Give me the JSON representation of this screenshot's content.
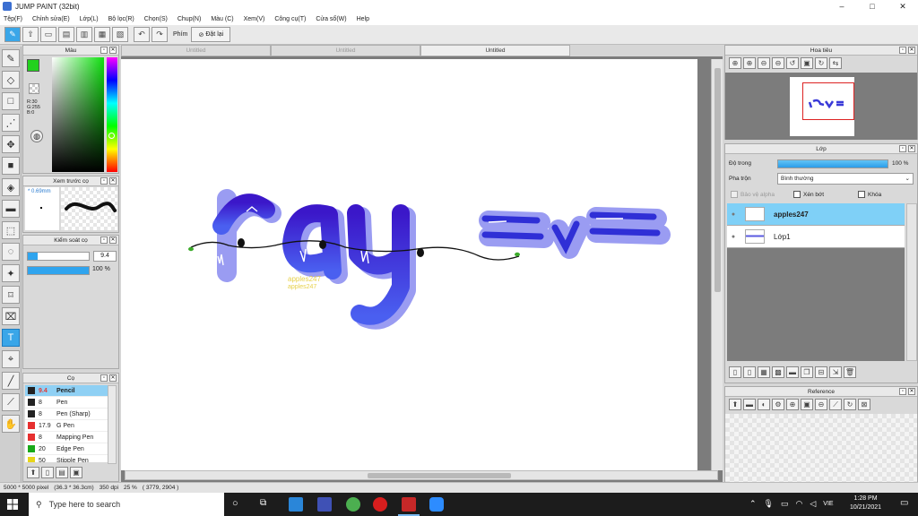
{
  "window": {
    "title": "JUMP PAINT (32bit)",
    "controls": [
      "–",
      "□",
      "✕"
    ]
  },
  "menu": [
    "Tệp(F)",
    "Chỉnh sửa(E)",
    "Lớp(L)",
    "Bộ lọc(R)",
    "Chọn(S)",
    "Chup(N)",
    "Màu (C)",
    "Xem(V)",
    "Công cụ(T)",
    "Cửa sổ(W)",
    "Help"
  ],
  "toolbar": {
    "phim_label": "Phím",
    "reset_label": "Đặt lại"
  },
  "tabs": [
    {
      "label": "Untitled",
      "active": false
    },
    {
      "label": "Untitled",
      "active": false
    },
    {
      "label": "Untitled",
      "active": true
    }
  ],
  "color_panel": {
    "title": "Màu",
    "values": [
      "R:30",
      "G:255",
      "B:0"
    ],
    "primary": "#22d11d",
    "secondary": "#f0d000"
  },
  "preview_panel": {
    "title": "Xem trước cọ",
    "size": "* 0.69mm"
  },
  "control_panel": {
    "title": "Kiểm soát cọ",
    "size_value": "9.4",
    "opacity_value": "100 %"
  },
  "brush_panel": {
    "title": "Cọ",
    "brushes": [
      {
        "size": "9.4",
        "name": "Pencil",
        "color": "#222222",
        "selected": true
      },
      {
        "size": "8",
        "name": "Pen",
        "color": "#222222"
      },
      {
        "size": "8",
        "name": "Pen (Sharp)",
        "color": "#222222"
      },
      {
        "size": "17.9",
        "name": "G Pen",
        "color": "#e63030"
      },
      {
        "size": "8",
        "name": "Mapping Pen",
        "color": "#e63030"
      },
      {
        "size": "20",
        "name": "Edge Pen",
        "color": "#19a919"
      },
      {
        "size": "50",
        "name": "Stipple Pen",
        "color": "#e8d51a"
      }
    ]
  },
  "navigator": {
    "title": "Hoa tiêu"
  },
  "layer_panel": {
    "title": "Lớp",
    "opacity_label": "Độ trong",
    "opacity_value": "100 %",
    "opacity_pct": 100,
    "blend_label": "Pha trộn",
    "blend_value": "Bình thường",
    "protect_alpha": "Bảo vệ alpha",
    "clipping": "Xén bớt",
    "lock": "Khóa",
    "layers": [
      {
        "name": "apples247",
        "selected": true
      },
      {
        "name": "Lớp1",
        "selected": false
      }
    ]
  },
  "reference_panel": {
    "title": "Reference"
  },
  "canvas": {
    "artwork_text": "ray",
    "emote_text": "=v=",
    "signature": "apples247",
    "colors": {
      "stroke": "#2b2bd6",
      "shadow": "#8888f0"
    }
  },
  "status": {
    "size": "5000 * 5000 pixel",
    "dims": "(36.3 * 36.3cm)",
    "dpi": "350 dpi",
    "zoom": "25 %",
    "coords": "( 3779, 2904 )"
  },
  "taskbar": {
    "search_placeholder": "Type here to search",
    "time": "1:28 PM",
    "date": "10/21/2021",
    "lang": "VIE"
  }
}
